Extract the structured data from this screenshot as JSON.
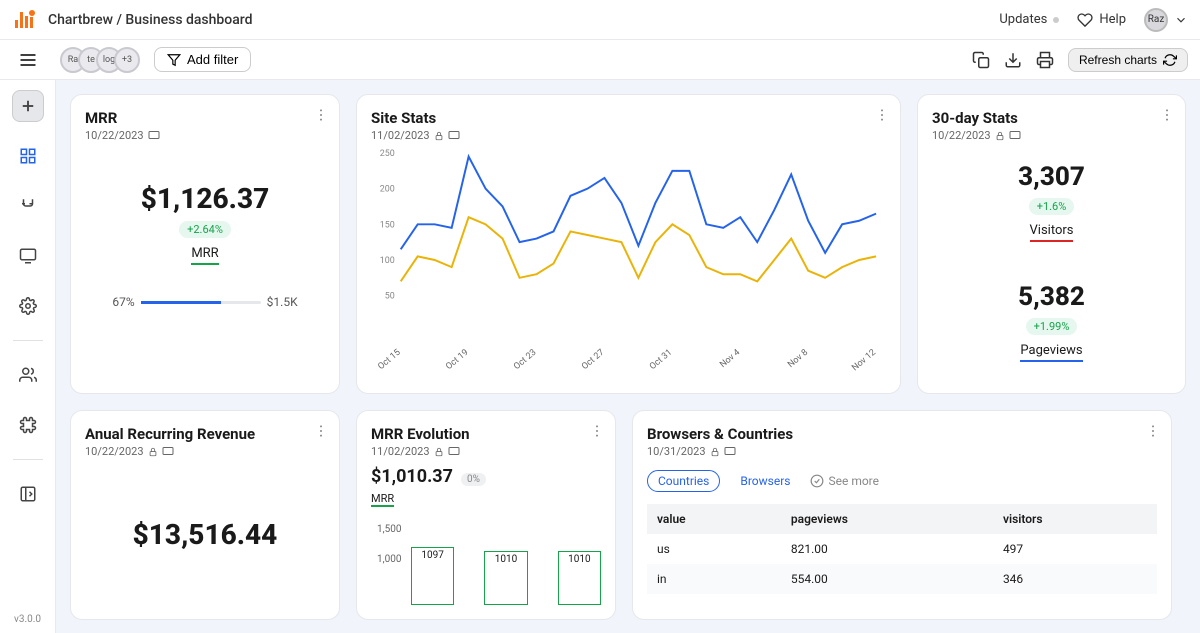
{
  "breadcrumb": "Chartbrew / Business dashboard",
  "topbar": {
    "updates": "Updates",
    "help": "Help",
    "user": "Raz"
  },
  "toolbar": {
    "filter_chips": [
      "Ra",
      "te",
      "log",
      "+3"
    ],
    "add_filter": "Add filter",
    "refresh": "Refresh charts"
  },
  "sidebar": {
    "version": "v3.0.0"
  },
  "cards": {
    "mrr": {
      "title": "MRR",
      "date": "10/22/2023",
      "value": "$1,126.37",
      "delta": "+2.64%",
      "label": "MRR",
      "progress_pct": "67%",
      "progress_max": "$1.5K"
    },
    "sitestats": {
      "title": "Site Stats",
      "date": "11/02/2023"
    },
    "day30": {
      "title": "30-day Stats",
      "date": "10/22/2023",
      "visitors_val": "3,307",
      "visitors_delta": "+1.6%",
      "visitors_label": "Visitors",
      "pageviews_val": "5,382",
      "pageviews_delta": "+1.99%",
      "pageviews_label": "Pageviews"
    },
    "arr": {
      "title": "Anual Recurring Revenue",
      "date": "10/22/2023",
      "value": "$13,516.44"
    },
    "mrrevo": {
      "title": "MRR Evolution",
      "date": "11/02/2023",
      "value": "$1,010.37",
      "delta": "0%",
      "label": "MRR",
      "ytick1": "1,500",
      "ytick2": "1,000"
    },
    "browsers": {
      "title": "Browsers & Countries",
      "date": "10/31/2023",
      "tab_countries": "Countries",
      "tab_browsers": "Browsers",
      "seemore": "See more",
      "col_value": "value",
      "col_pageviews": "pageviews",
      "col_visitors": "visitors",
      "rows": [
        {
          "value": "us",
          "pageviews": "821.00",
          "visitors": "497"
        },
        {
          "value": "in",
          "pageviews": "554.00",
          "visitors": "346"
        }
      ]
    }
  },
  "chart_data": [
    {
      "type": "line",
      "title": "Site Stats",
      "x_categories": [
        "Oct 15",
        "Oct 19",
        "Oct 23",
        "Oct 27",
        "Oct 31",
        "Nov 4",
        "Nov 8",
        "Nov 12"
      ],
      "ylim": [
        0,
        250
      ],
      "yticks": [
        50,
        100,
        150,
        200,
        250
      ],
      "series": [
        {
          "name": "Visitors",
          "color": "#eab308",
          "values": [
            70,
            105,
            100,
            90,
            160,
            150,
            130,
            75,
            80,
            95,
            140,
            135,
            130,
            125,
            75,
            125,
            150,
            135,
            90,
            80,
            80,
            70,
            100,
            130,
            85,
            75,
            90,
            100,
            105
          ]
        },
        {
          "name": "Pageviews",
          "color": "#2563eb",
          "values": [
            115,
            150,
            150,
            145,
            245,
            200,
            175,
            125,
            130,
            140,
            190,
            200,
            215,
            180,
            120,
            180,
            225,
            225,
            150,
            145,
            160,
            125,
            170,
            220,
            155,
            110,
            150,
            155,
            165
          ]
        }
      ]
    },
    {
      "type": "bar",
      "title": "MRR Evolution",
      "categories": [
        "",
        "",
        ""
      ],
      "values": [
        1097,
        1010,
        1010
      ],
      "ylim": [
        0,
        1500
      ],
      "ylabel": "",
      "xlabel": ""
    }
  ]
}
